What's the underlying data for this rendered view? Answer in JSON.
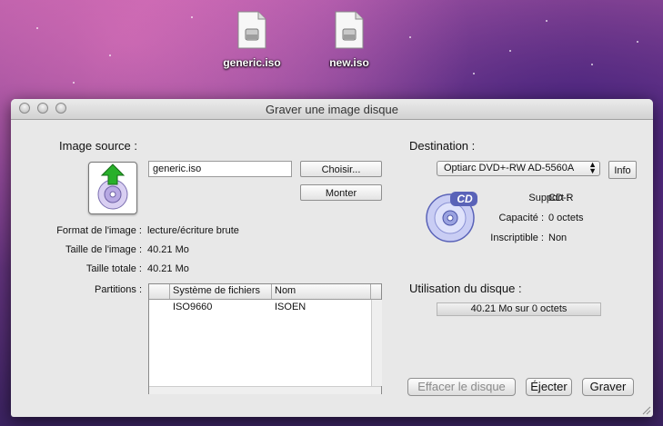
{
  "desktop": {
    "icons": [
      {
        "label": "generic.iso"
      },
      {
        "label": "new.iso"
      }
    ]
  },
  "window": {
    "title": "Graver une image disque",
    "source": {
      "heading": "Image source :",
      "filename": "generic.iso",
      "choose_button": "Choisir...",
      "mount_button": "Monter",
      "format_label": "Format de l'image :",
      "format_value": "lecture/écriture brute",
      "image_size_label": "Taille de l'image :",
      "image_size_value": "40.21 Mo",
      "total_size_label": "Taille totale :",
      "total_size_value": "40.21 Mo",
      "partitions_label": "Partitions :",
      "partitions_columns": [
        "Système de fichiers",
        "Nom"
      ],
      "partitions_rows": [
        [
          "ISO9660",
          "ISOEN"
        ]
      ]
    },
    "destination": {
      "heading": "Destination :",
      "drive": "Optiarc DVD+-RW AD-5560A",
      "info_button": "Info",
      "media_badge": "CD",
      "support_label": "Support :",
      "support_value": "CD-R",
      "capacity_label": "Capacité :",
      "capacity_value": "0 octets",
      "writable_label": "Inscriptible :",
      "writable_value": "Non"
    },
    "usage": {
      "heading": "Utilisation du disque :",
      "value": "40.21 Mo sur 0 octets"
    },
    "buttons": {
      "erase": "Effacer le disque",
      "eject": "Éjecter",
      "burn": "Graver"
    }
  }
}
